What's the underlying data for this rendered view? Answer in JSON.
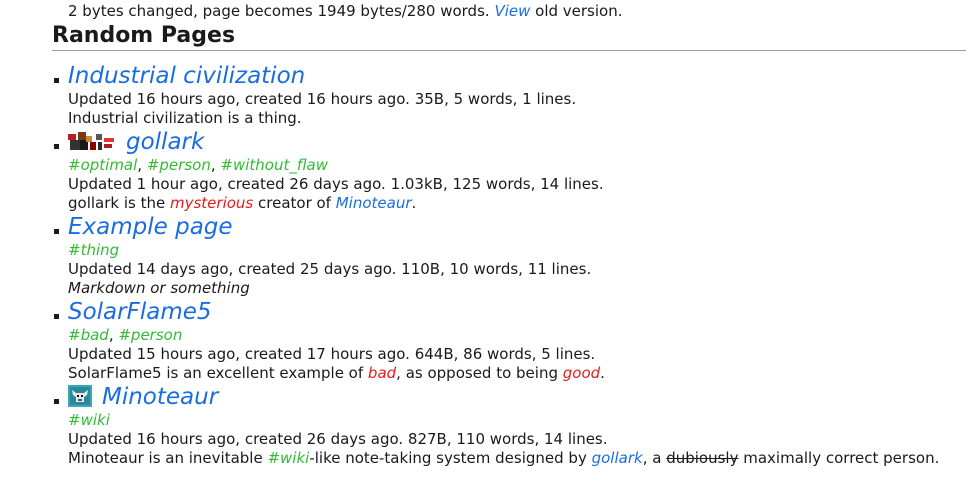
{
  "revision": {
    "prefix": "2 bytes changed, page becomes 1949 bytes/280 words. ",
    "link": "View",
    "suffix": " old version."
  },
  "section": {
    "title": "Random Pages"
  },
  "pages": [
    {
      "title": "Industrial civilization",
      "tags": [],
      "meta": "Updated 16 hours ago, created 16 hours ago. 35B, 5 words, 1 lines.",
      "description": "Industrial civilization is a thing."
    },
    {
      "title": "gollark",
      "avatar_icon": "pixel-avatar-icon",
      "tags": [
        "#optimal",
        "#person",
        "#without_flaw"
      ],
      "meta": "Updated 1 hour ago, created 26 days ago. 1.03kB, 125 words, 14 lines.",
      "description": {
        "p1": "gollark is the ",
        "red": "mysterious",
        "p2": " creator of ",
        "link": "Minoteaur",
        "p3": "."
      }
    },
    {
      "title": "Example page",
      "tags": [
        "#thing"
      ],
      "meta": "Updated 14 days ago, created 25 days ago. 110B, 10 words, 11 lines.",
      "description": "Markdown or something"
    },
    {
      "title": "SolarFlame5",
      "tags": [
        "#bad",
        "#person"
      ],
      "meta": "Updated 15 hours ago, created 17 hours ago. 644B, 86 words, 5 lines.",
      "description": {
        "p1": "SolarFlame5 is an excellent example of ",
        "red1": "bad",
        "p2": ", as opposed to being ",
        "red2": "good",
        "p3": "."
      }
    },
    {
      "title": "Minoteaur",
      "avatar_icon": "minotaur-logo-icon",
      "tags": [
        "#wiki"
      ],
      "meta": "Updated 16 hours ago, created 26 days ago. 827B, 110 words, 14 lines.",
      "description": {
        "p1": "Minoteaur is an inevitable ",
        "tag": "#wiki",
        "p2": "-like note-taking system designed by ",
        "link": "gollark",
        "p3": ", a ",
        "strike": "dubiously",
        "p4": " maximally correct person."
      }
    }
  ],
  "colors": {
    "link": "#1a6de0",
    "red": "#e21c1c",
    "tag": "#33bb33"
  }
}
